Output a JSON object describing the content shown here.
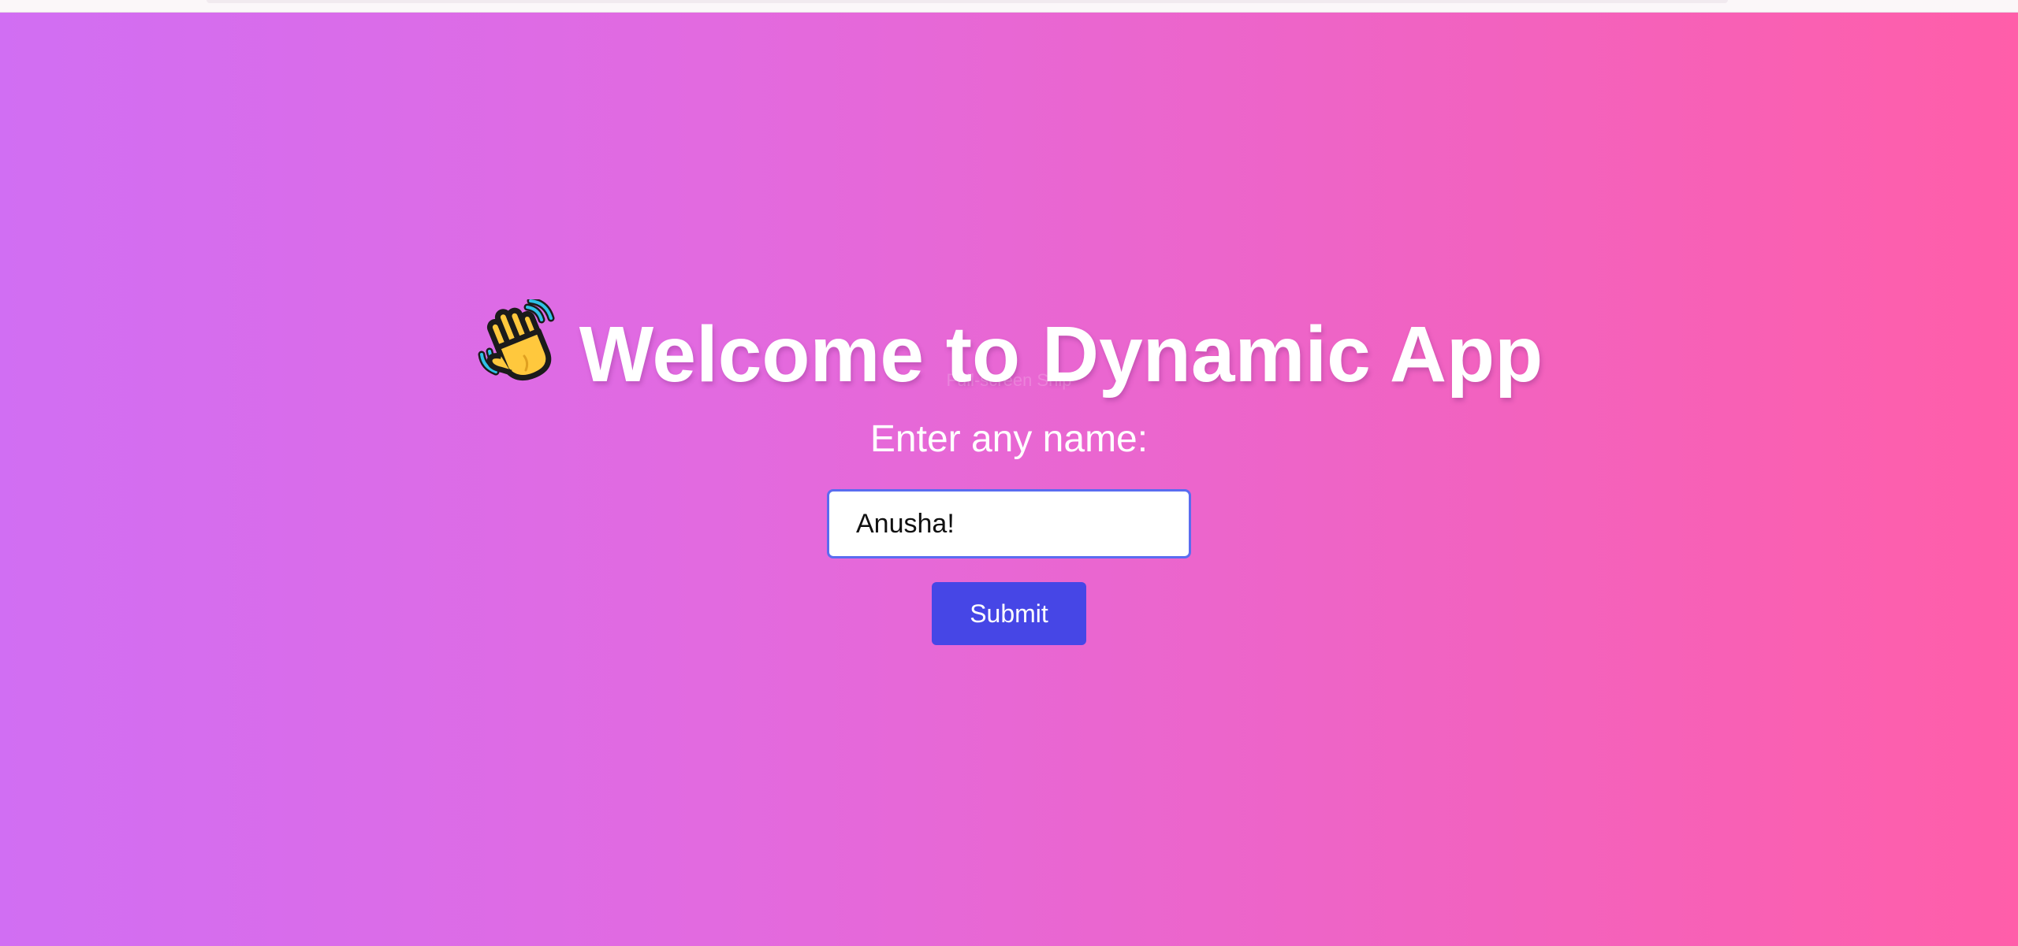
{
  "page": {
    "background_start": "#d16ef3",
    "background_end": "#ff5ea9"
  },
  "header": {
    "icon": "waving-hand-icon",
    "title": "Welcome to Dynamic App"
  },
  "overlay": {
    "caption": "Full-screen Snip"
  },
  "form": {
    "prompt_label": "Enter any name:",
    "name_value": "Anusha!",
    "submit_label": "Submit",
    "input_border_color": "#5a6cf0",
    "button_color": "#4646e6"
  }
}
